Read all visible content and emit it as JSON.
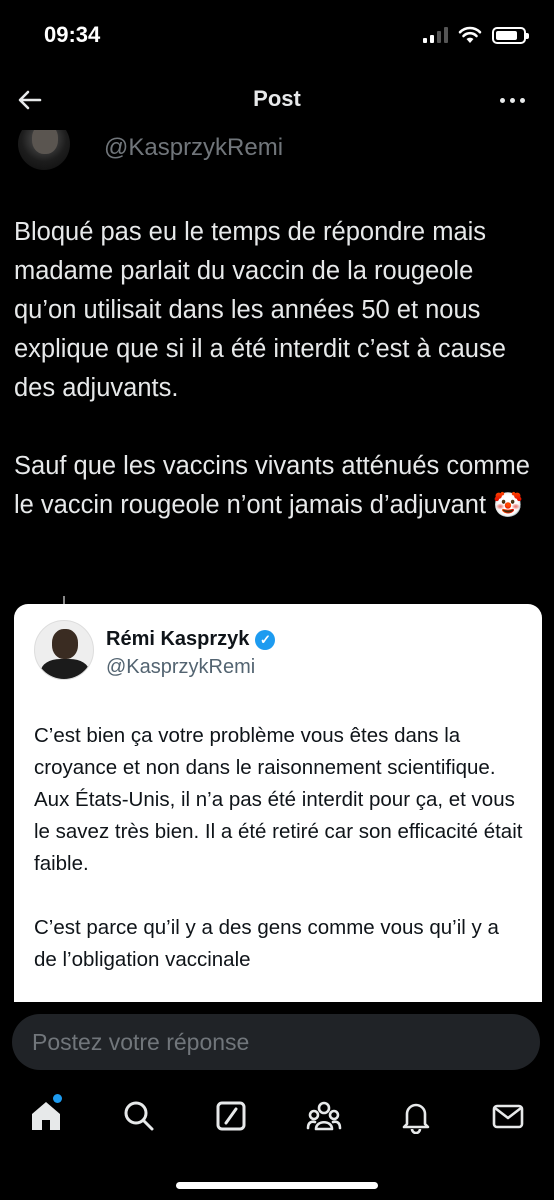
{
  "status_bar": {
    "time": "09:34"
  },
  "header": {
    "title": "Post"
  },
  "post": {
    "handle": "@KasprzykRemi",
    "paragraphs": [
      "Bloqué pas eu le temps de répondre mais madame parlait du vaccin de la rougeole qu’on utilisait dans les années 50 et nous explique que si il a été interdit c’est à cause des adjuvants.",
      "Sauf que les vaccins vivants atténués comme le vaccin rougeole n’ont jamais d’adjuvant"
    ],
    "emoji": "🤡"
  },
  "quoted": {
    "name": "Rémi Kasprzyk",
    "verified_mark": "✓",
    "handle": "@KasprzykRemi",
    "paragraphs": [
      "C’est bien ça votre problème vous êtes dans la croyance et non dans le raisonnement scientifique. Aux États-Unis, il n’a pas été interdit pour ça, et vous le savez très bien. Il a été retiré car son efficacité était faible.",
      "C’est parce qu’il y a des gens comme vous qu’il y a de l’obligation vaccinale"
    ]
  },
  "reply": {
    "placeholder": "Postez votre réponse"
  },
  "nav": {
    "items": [
      "home-icon",
      "search-icon",
      "grok-icon",
      "communities-icon",
      "notifications-icon",
      "messages-icon"
    ]
  },
  "colors": {
    "accent": "#1d9bf0",
    "background": "#000000",
    "text": "#e7e9ea",
    "muted": "#71767b"
  },
  "battery_level": 0.8
}
